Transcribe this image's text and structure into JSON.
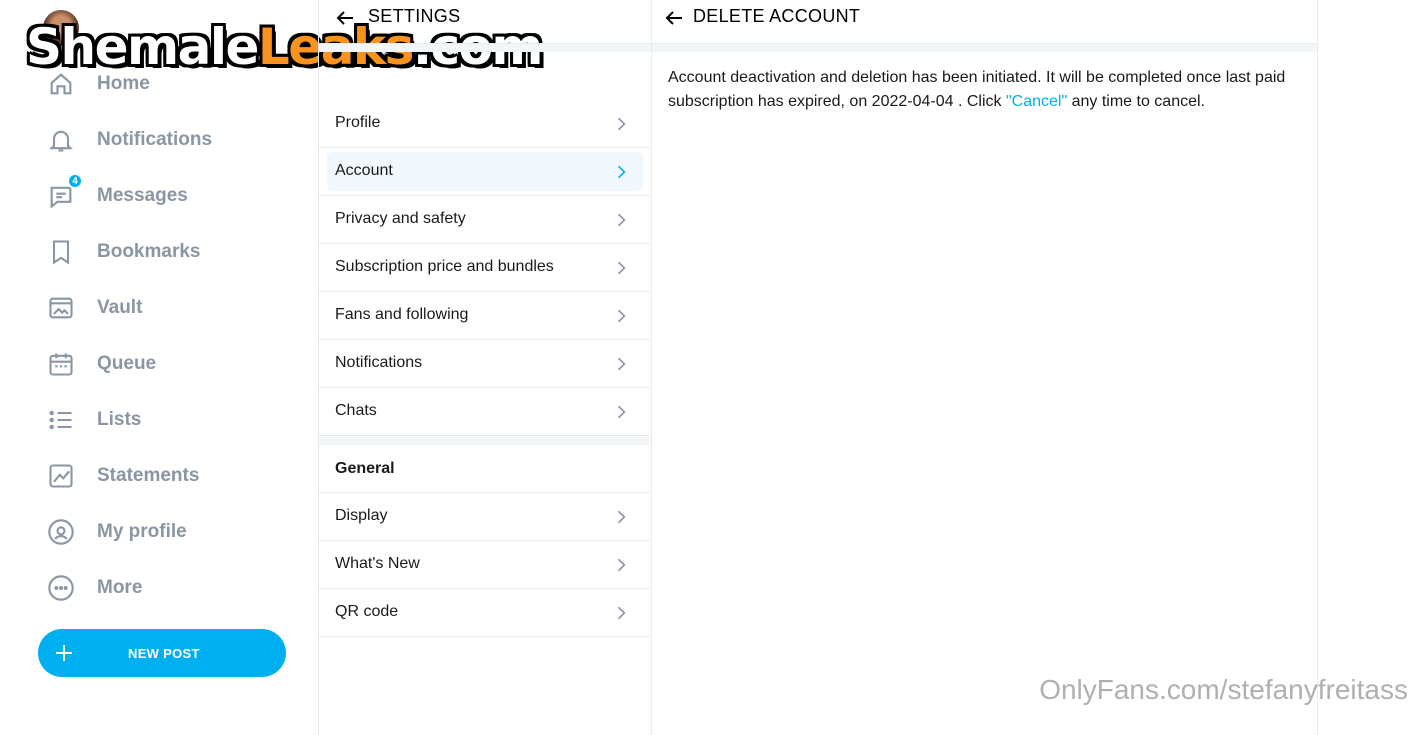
{
  "watermark_top": {
    "part1": "Shemale",
    "part2": "Leaks",
    "part3": ".com"
  },
  "watermark_bottom": "OnlyFans.com/stefanyfreitass",
  "sidebar": {
    "items": [
      {
        "label": "Home",
        "icon": "home-icon"
      },
      {
        "label": "Notifications",
        "icon": "bell-icon"
      },
      {
        "label": "Messages",
        "icon": "chat-icon",
        "badge": "4"
      },
      {
        "label": "Bookmarks",
        "icon": "bookmark-icon"
      },
      {
        "label": "Vault",
        "icon": "image-icon"
      },
      {
        "label": "Queue",
        "icon": "calendar-icon"
      },
      {
        "label": "Lists",
        "icon": "list-icon"
      },
      {
        "label": "Statements",
        "icon": "chart-icon"
      },
      {
        "label": "My profile",
        "icon": "user-circle-icon"
      },
      {
        "label": "More",
        "icon": "more-icon"
      }
    ],
    "new_post_label": "NEW POST"
  },
  "settings": {
    "title": "SETTINGS",
    "rows": [
      {
        "label": "Profile"
      },
      {
        "label": "Account",
        "active": true
      },
      {
        "label": "Privacy and safety"
      },
      {
        "label": "Subscription price and bundles"
      },
      {
        "label": "Fans and following"
      },
      {
        "label": "Notifications"
      },
      {
        "label": "Chats"
      }
    ],
    "general_title": "General",
    "general_rows": [
      {
        "label": "Display"
      },
      {
        "label": "What's New"
      },
      {
        "label": "QR code"
      }
    ]
  },
  "detail": {
    "title": "DELETE ACCOUNT",
    "text_before": "Account deactivation and deletion has been initiated. It will be completed once last paid subscription has expired, on 2022-04-04 . Click ",
    "link_text": "\"Cancel\"",
    "text_after": " any time to cancel."
  },
  "colors": {
    "accent": "#00aff0",
    "nav_text": "#8a96a3",
    "border": "#e6ebee"
  }
}
